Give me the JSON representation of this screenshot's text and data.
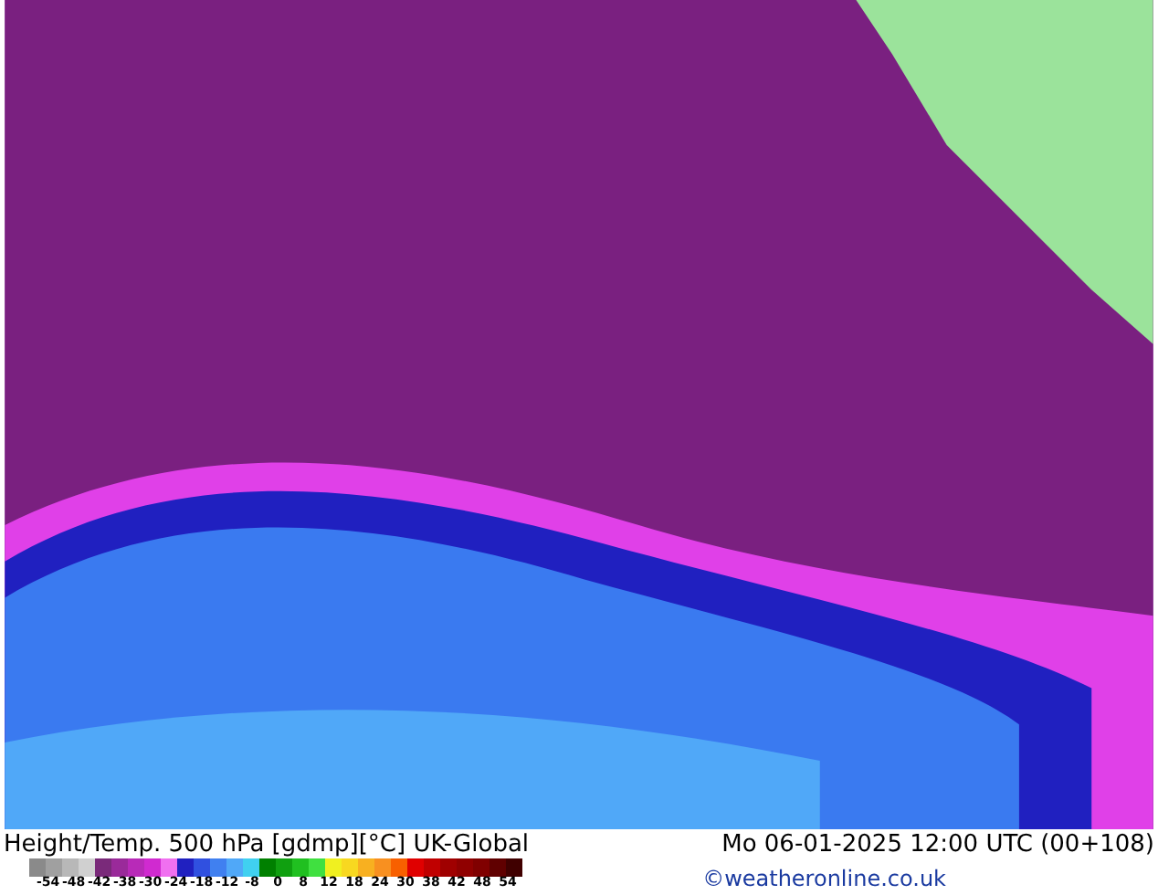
{
  "title": "Height/Temp. 500 hPa [gdmp][°C] UK-Global",
  "datetime": "Mo 06-01-2025 12:00 UTC (00+108)",
  "legend": {
    "ticks": [
      "-54",
      "-48",
      "-42",
      "-38",
      "-30",
      "-24",
      "-18",
      "-12",
      "-8",
      "0",
      "8",
      "12",
      "18",
      "24",
      "30",
      "38",
      "42",
      "48",
      "54"
    ]
  },
  "credit": "©weatheronline.co.uk"
}
